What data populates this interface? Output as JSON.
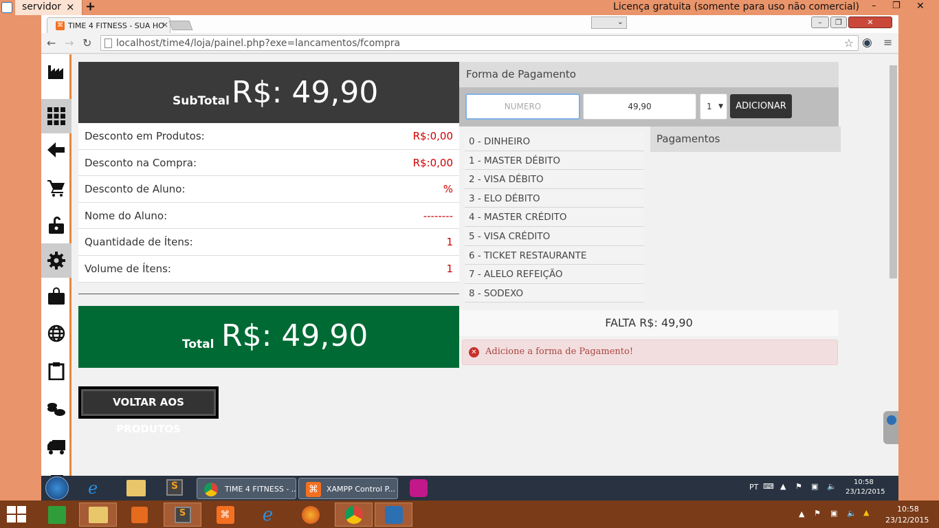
{
  "teamviewer": {
    "tab": "servidor",
    "license": "Licença gratuita (somente para uso não comercial)"
  },
  "browser": {
    "tab_title": "TIME 4 FITNESS - SUA HO",
    "url": "localhost/time4/loja/painel.php?exe=lancamentos/fcompra"
  },
  "sidebar": {
    "items": [
      "factory-icon",
      "grid-icon",
      "back-arrow-icon",
      "cart-icon",
      "unlock-icon",
      "gear-icon",
      "bag-icon",
      "globe-icon",
      "clipboard-icon",
      "coins-icon",
      "truck-icon",
      "notebook-icon"
    ]
  },
  "summary": {
    "subtotal_label": "SubTotal",
    "subtotal_value": "R$: 49,90",
    "rows": [
      {
        "label": "Desconto em Produtos:",
        "value": "R$:0,00"
      },
      {
        "label": "Desconto na Compra:",
        "value": "R$:0,00"
      },
      {
        "label": "Desconto de Aluno:",
        "value": "%"
      },
      {
        "label": "Nome do Aluno:",
        "value": "--------"
      },
      {
        "label": "Quantidade de Ítens:",
        "value": "1"
      },
      {
        "label": "Volume de Ítens:",
        "value": "1"
      }
    ],
    "total_label": "Total",
    "total_value": "R$: 49,90",
    "back_button": "VOLTAR AOS PRODUTOS"
  },
  "payment": {
    "heading": "Forma de Pagamento",
    "number_placeholder": "NUMERO",
    "amount_value": "49,90",
    "quantity_value": "1",
    "add_button": "ADICIONAR",
    "methods": [
      "0 - DINHEIRO",
      "1 - MASTER DÉBITO",
      "2 - VISA DÉBITO",
      "3 - ELO DÉBITO",
      "4 - MASTER CRÉDITO",
      "5 - VISA CRÉDITO",
      "6 - TICKET RESTAURANTE",
      "7 - ALELO REFEIÇÃO",
      "8 - SODEXO"
    ],
    "payments_heading": "Pagamentos",
    "remaining": "FALTA R$: 49,90",
    "alert": "Adicione a forma de Pagamento!"
  },
  "taskbar_inner": {
    "windows": [
      "TIME 4 FITNESS - ...",
      "XAMPP Control P..."
    ],
    "lang": "PT",
    "time": "10:58",
    "date": "23/12/2015"
  },
  "taskbar_outer": {
    "time": "10:58",
    "date": "23/12/2015"
  }
}
